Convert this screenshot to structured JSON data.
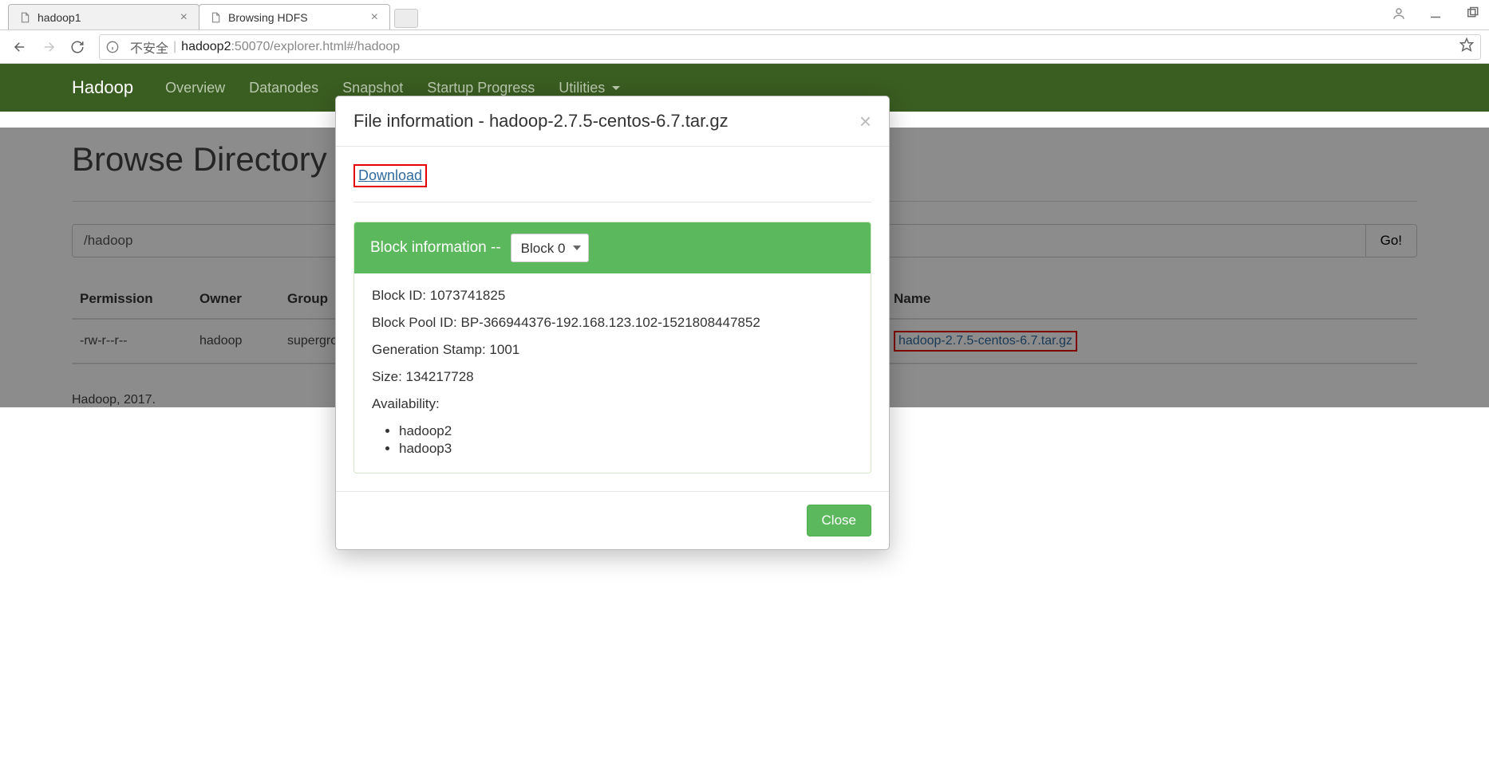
{
  "chrome": {
    "tabs": [
      {
        "title": "hadoop1"
      },
      {
        "title": "Browsing HDFS"
      }
    ],
    "address": {
      "insecure_label": "不安全",
      "host": "hadoop2",
      "rest": ":50070/explorer.html#/hadoop"
    }
  },
  "hadoop_nav": {
    "brand": "Hadoop",
    "items": [
      "Overview",
      "Datanodes",
      "Snapshot",
      "Startup Progress",
      "Utilities"
    ]
  },
  "page": {
    "title": "Browse Directory",
    "path_value": "/hadoop",
    "go_label": "Go!",
    "footer": "Hadoop, 2017."
  },
  "table": {
    "headers": [
      "Permission",
      "Owner",
      "Group",
      "Name"
    ],
    "row": {
      "permission": "-rw-r--r--",
      "owner": "hadoop",
      "group": "supergroup",
      "name": "hadoop-2.7.5-centos-6.7.tar.gz"
    }
  },
  "modal": {
    "title": "File information - hadoop-2.7.5-centos-6.7.tar.gz",
    "download_label": "Download",
    "block_info_label": "Block information --",
    "block_select_value": "Block 0",
    "block_id_label": "Block ID: 1073741825",
    "block_pool_label": "Block Pool ID: BP-366944376-192.168.123.102-1521808447852",
    "gen_stamp_label": "Generation Stamp: 1001",
    "size_label": "Size: 134217728",
    "availability_label": "Availability:",
    "availability": [
      "hadoop2",
      "hadoop3"
    ],
    "close_label": "Close"
  }
}
